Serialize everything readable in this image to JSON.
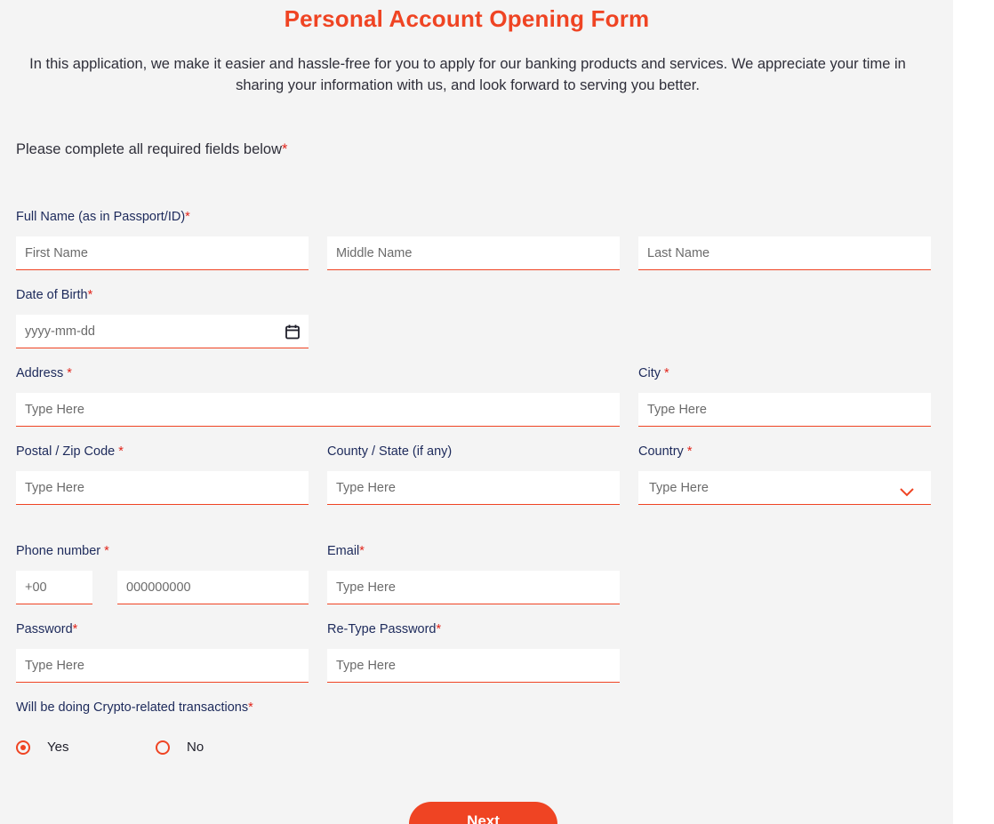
{
  "form": {
    "title": "Personal Account Opening Form",
    "intro": "In this application, we make it easier and hassle-free for you to apply for our banking products and services. We appreciate your time in sharing your information with us, and look forward to serving you better.",
    "required_note": "Please complete all required fields below",
    "required_mark": "*"
  },
  "fields": {
    "full_name_label": "Full Name (as in Passport/ID)",
    "first_name_placeholder": "First Name",
    "middle_name_placeholder": "Middle Name",
    "last_name_placeholder": "Last Name",
    "dob_label": "Date of Birth",
    "dob_placeholder": "yyyy-mm-dd",
    "address_label": "Address ",
    "address_placeholder": "Type Here",
    "city_label": "City ",
    "city_placeholder": "Type Here",
    "postal_label": "Postal / Zip Code ",
    "postal_placeholder": "Type Here",
    "county_label": "County / State (if any)",
    "county_placeholder": "Type Here",
    "country_label": "Country ",
    "country_placeholder": "Type Here",
    "phone_label": "Phone number ",
    "phone_code_placeholder": "+00",
    "phone_number_placeholder": "000000000",
    "email_label": "Email",
    "email_placeholder": "Type Here",
    "password_label": "Password",
    "password_placeholder": "Type Here",
    "retype_password_label": "Re-Type Password",
    "retype_password_placeholder": "Type Here",
    "crypto_label": "Will be doing Crypto-related transactions",
    "crypto_options": [
      "Yes",
      "No"
    ],
    "crypto_selected": "Yes"
  },
  "actions": {
    "next_label": "Next"
  },
  "colors": {
    "accent": "#ef4423",
    "label": "#1d2a5b",
    "background": "#f4f4f4"
  },
  "icons": {
    "date_picker": "calendar-icon",
    "country_select": "chevron-down-icon"
  }
}
